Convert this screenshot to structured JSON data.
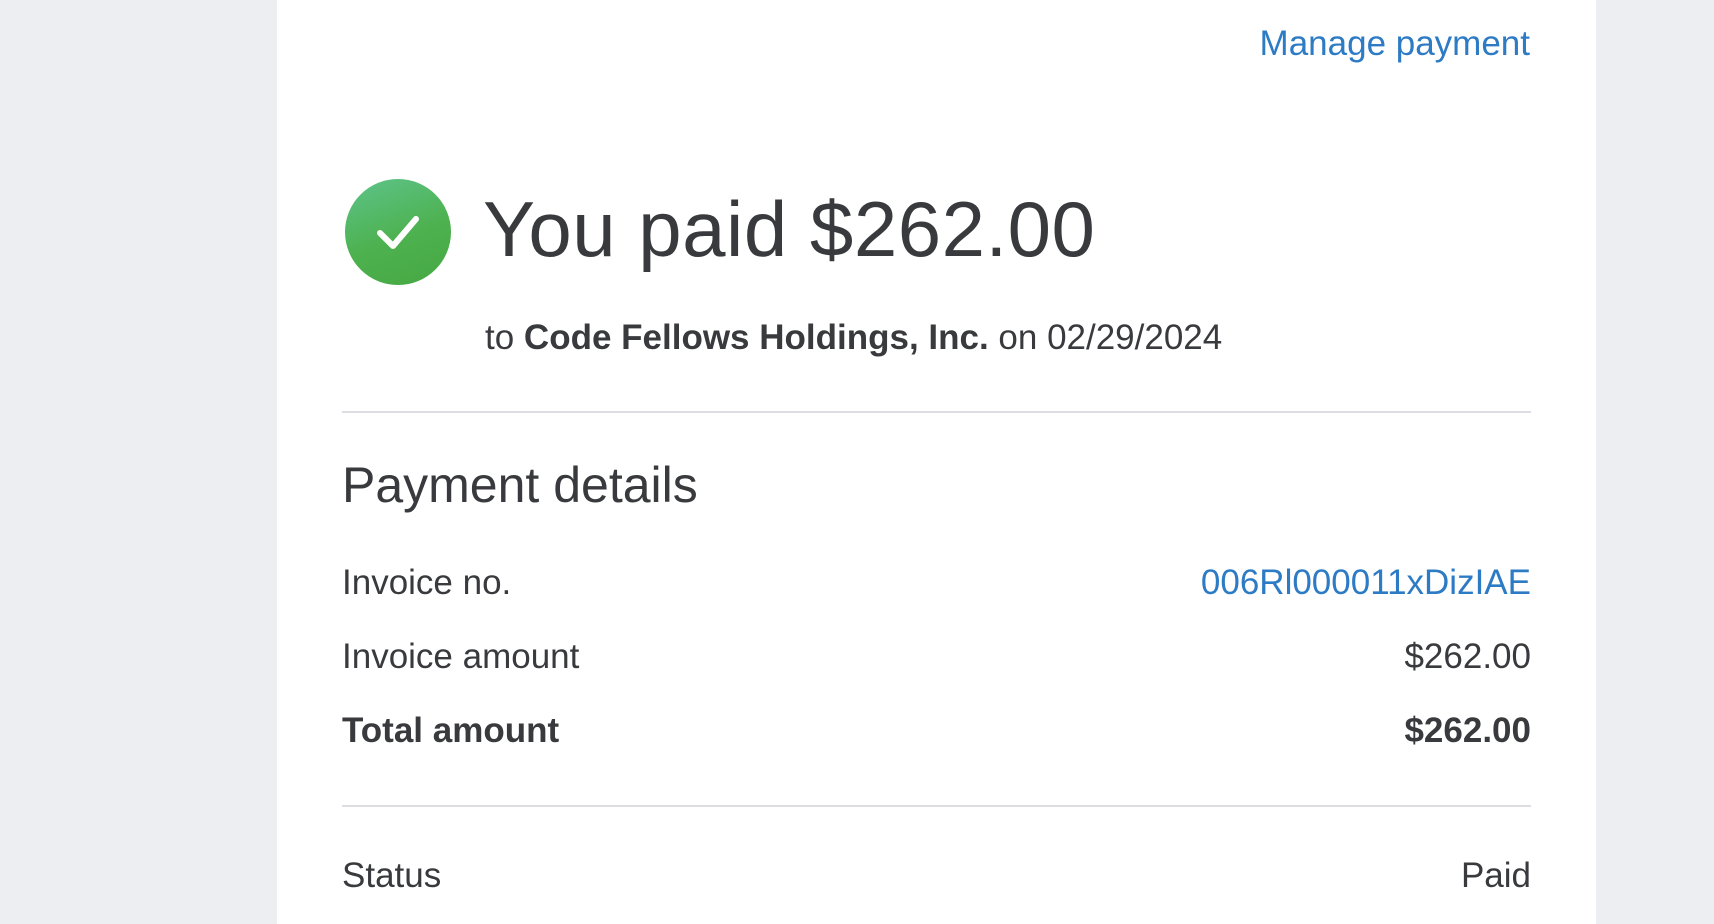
{
  "header": {
    "manage_payment_label": "Manage payment"
  },
  "confirmation": {
    "headline": "You paid $262.00",
    "prefix": "to ",
    "payee": "Code Fellows Holdings, Inc.",
    "date_text": " on 02/29/2024",
    "icon": "check-circle-icon",
    "icon_color": "#4db14f"
  },
  "details": {
    "title": "Payment details",
    "invoice_no_label": "Invoice no.",
    "invoice_no_value": "006Rl000011xDizIAE",
    "invoice_amount_label": "Invoice amount",
    "invoice_amount_value": "$262.00",
    "total_amount_label": "Total amount",
    "total_amount_value": "$262.00",
    "status_label": "Status",
    "status_value": "Paid"
  },
  "colors": {
    "link": "#2d7bc4",
    "text": "#393a3d",
    "background": "#eceef1"
  }
}
